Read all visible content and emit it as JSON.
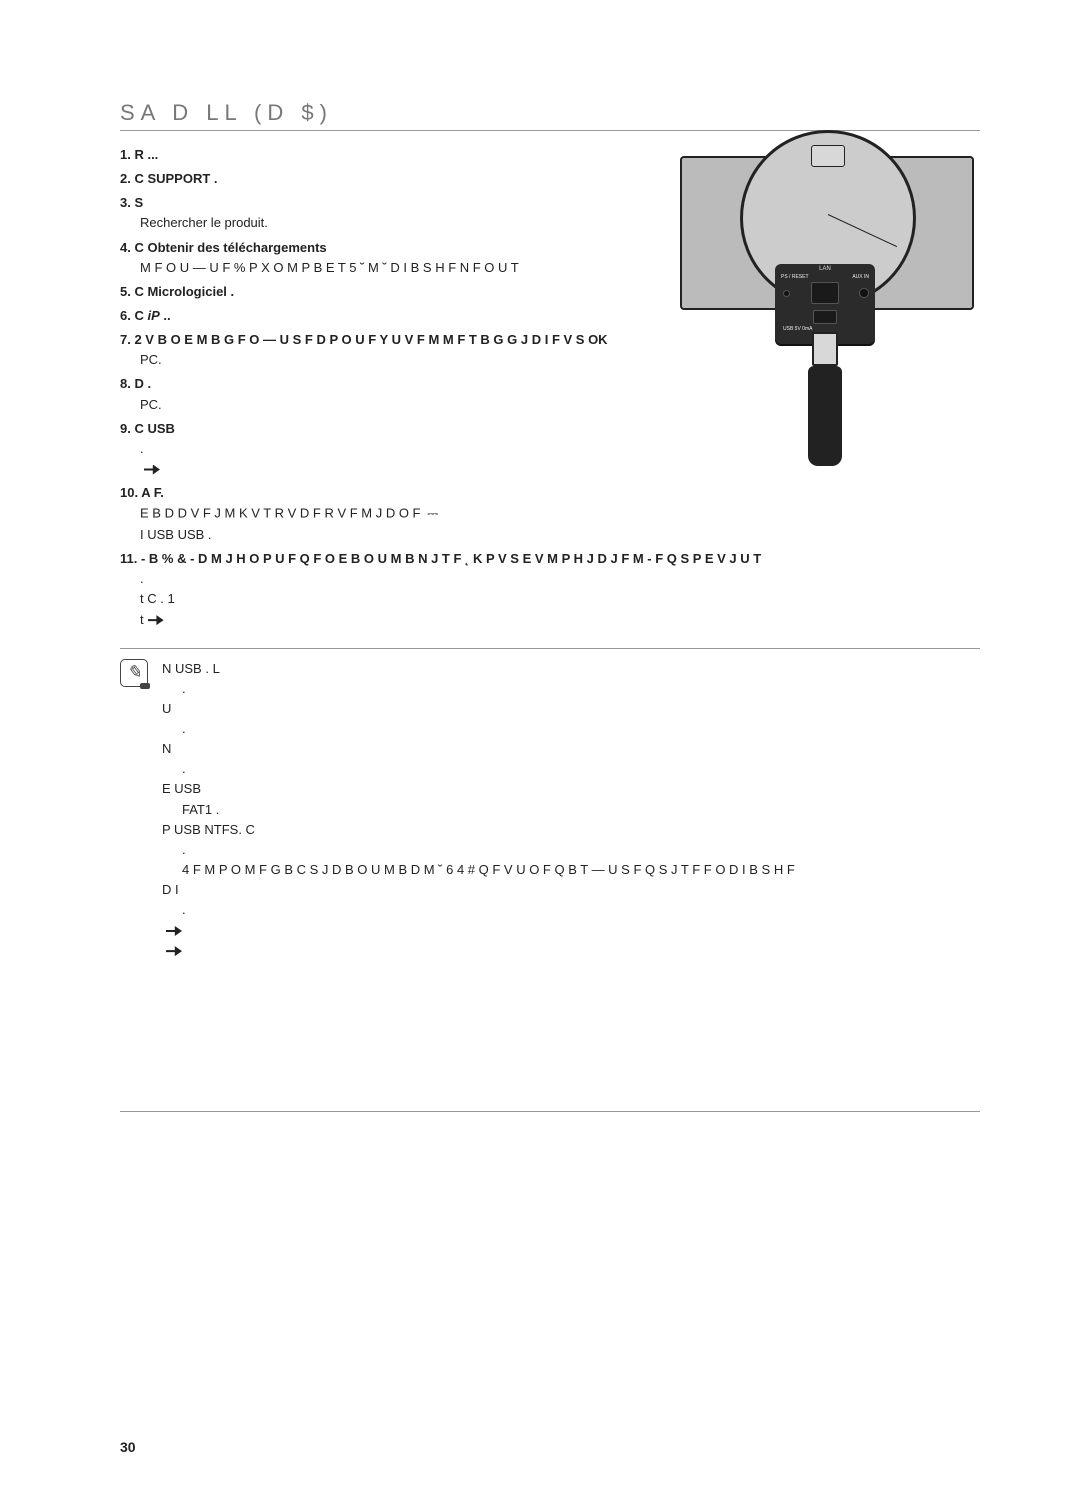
{
  "page_number": "30",
  "section_title": "SA D LL (D $)",
  "device_labels": {
    "lan": "LAN",
    "wps_reset": "PS / RESET",
    "aux_in": "AUX IN",
    "usb_5v": "USB 5V   0mA"
  },
  "steps": {
    "s1": "1.  R   ...",
    "s2": "2.  C  SUPPORT      .",
    "s3": "3.  S",
    "s3_sub": "Rechercher le produit.",
    "s4": "4.  C  Obtenir des téléchargements",
    "s4_sub": "M  F O  U — U F  % P X O M P B E T   5 ˘ M ˘ D I B S H F N F O U T",
    "s5": "5.  C  Micrologiciel     .",
    "s6_pre": "6.  C  ",
    "s6_icon_label": "iP",
    "s6_post": "   ..",
    "s7": "7.  2 V B O E  M B  G F O — U S F  D P O U F Y U V F M M F  T  B G G J D I F               V S  OK",
    "s7_sub": "PC.",
    "s8": "8.  D  .",
    "s8_sub": "PC.",
    "s9": "9.  C        USB",
    "s9_sub1": ".",
    "s10": "10. A                                                       F.",
    "s10_sub1": "E  B D D V F J M  K V T R V   D F  R V F  M  J D  O F",
    "s10_sub2": "I  USB   USB    .",
    "s11": "11.  - B  % & -  D M J H O P U F  Q F O E B O U  M B  N J T F  ˛  K P V S  E V  M P H J D J F M   - F  Q S P E V J U  T",
    "s11_sub1": ".",
    "s11_sub2": "t C        . 1",
    "s11_sub3": "t"
  },
  "notes": {
    "n1": "N       USB   . L",
    "n1b": ".",
    "n2": "U",
    "n2b": ".",
    "n3": "N",
    "n3b": ".",
    "n4": "E          USB",
    "n4b": "FAT1     .",
    "n5": "P        USB  NTFS. C",
    "n5b": ".",
    "n6": "4 F M P O  M F  G B C S J D B O U   M B  D M ˘  6 4 #  Q F V U  O F  Q B T  — U S F  Q S J T F  F O  D I B S H F",
    "n6b": "D     I",
    "n6c": "."
  }
}
